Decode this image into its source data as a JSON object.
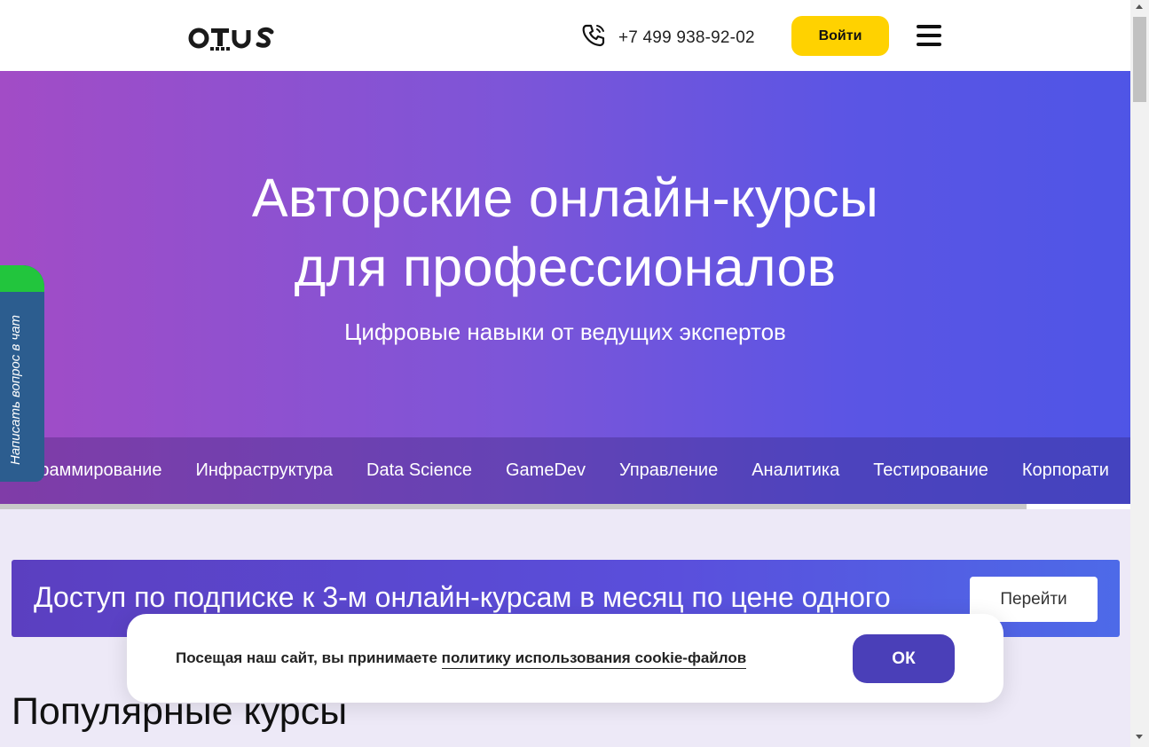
{
  "header": {
    "logo_text": "otus",
    "phone": "+7 499 938-92-02",
    "login_label": "Войти"
  },
  "hero": {
    "title_line1": "Авторские онлайн-курсы",
    "title_line2": "для профессионалов",
    "subtitle": "Цифровые навыки от ведущих экспертов",
    "categories": [
      "ограммирование",
      "Инфраструктура",
      "Data Science",
      "GameDev",
      "Управление",
      "Аналитика",
      "Тестирование",
      "Корпорати"
    ]
  },
  "chat_tab": {
    "label": "Написать вопрос в чат"
  },
  "subscription": {
    "text": "Доступ по подписке к 3-м онлайн-курсам в месяц по цене одного",
    "button_label": "Перейти"
  },
  "popular": {
    "title": "Популярные курсы"
  },
  "cookie": {
    "text_prefix": "Посещая наш сайт, вы принимаете ",
    "link_text": "политику использования cookie-файлов",
    "ok_label": "ОК"
  },
  "colors": {
    "login_button": "#ffd200",
    "hero_gradient_start": "#a24cc6",
    "hero_gradient_end": "#4f55e6",
    "ok_button": "#4a3fb8",
    "chat_tab": "#2c5d8f",
    "chat_tab_accent": "#22c53d"
  },
  "icons": {
    "phone": "phone-icon",
    "menu": "hamburger-menu-icon"
  }
}
